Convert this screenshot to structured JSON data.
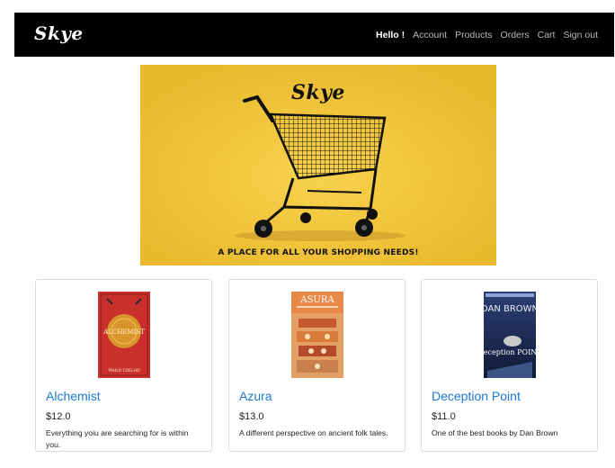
{
  "navbar": {
    "brand": "Skye",
    "greeting": "Hello !",
    "links": [
      "Account",
      "Products",
      "Orders",
      "Cart",
      "Sign out"
    ]
  },
  "hero": {
    "logo_text": "Skye",
    "tagline": "A PLACE FOR ALL YOUR SHOPPING NEEDS!",
    "background_color": "#efc43a"
  },
  "products": [
    {
      "title": "Alchemist",
      "price": "$12.0",
      "description": "Everything yoiu are searching for is within you.",
      "cover": {
        "title_text": "ALCHEMIST",
        "author_text": "PAULO COELHO",
        "color": "#c9302c"
      }
    },
    {
      "title": "Azura",
      "price": "$13.0",
      "description": "A different perspective on ancient folk tales.",
      "cover": {
        "title_text": "ASURA",
        "color": "#e4a064"
      }
    },
    {
      "title": "Deception Point",
      "price": "$11.0",
      "description": "One of the best books by Dan Brown",
      "cover": {
        "title_text": "Deception POINT",
        "author_text": "DAN BROWN",
        "color": "#2b3f74"
      }
    }
  ],
  "colors": {
    "link": "#1a7ad4",
    "navbar": "#000000"
  }
}
